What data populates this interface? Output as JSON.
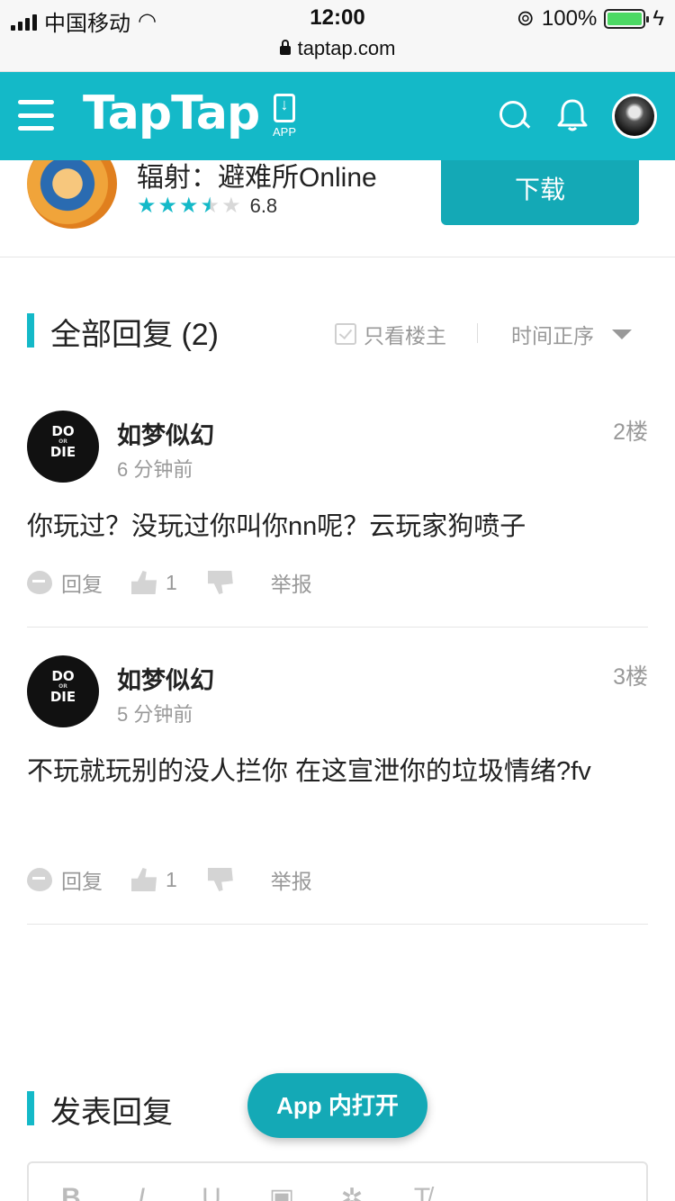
{
  "status_bar": {
    "carrier": "中国移动",
    "time": "12:00",
    "battery": "100%"
  },
  "browser": {
    "url": "taptap.com"
  },
  "header": {
    "logo": "TapTap",
    "app_label": "APP"
  },
  "game": {
    "title": "辐射：避难所Online",
    "rating": "6.8",
    "stars_filled": 3.5,
    "download": "下载"
  },
  "replies_section": {
    "title": "全部回复 (2)",
    "only_op": "只看楼主",
    "sort": "时间正序"
  },
  "replies": [
    {
      "name": "如梦似幻",
      "time": "6 分钟前",
      "floor": "2楼",
      "content": "你玩过？没玩过你叫你nn呢？云玩家狗喷子",
      "reply": "回复",
      "likes": "1",
      "report": "举报",
      "avatar_top": "DO",
      "avatar_mid": "OR",
      "avatar_bottom": "DIE"
    },
    {
      "name": "如梦似幻",
      "time": "5 分钟前",
      "floor": "3楼",
      "content": "不玩就玩别的没人拦你 在这宣泄你的垃圾情绪?fv",
      "reply": "回复",
      "likes": "1",
      "report": "举报",
      "avatar_top": "DO",
      "avatar_mid": "OR",
      "avatar_bottom": "DIE"
    }
  ],
  "compose": {
    "title": "发表回复",
    "open_in_app": "App 内打开",
    "tools": [
      "B",
      "I",
      "U",
      "▣",
      "✲",
      "T̸"
    ]
  },
  "colors": {
    "brand": "#14b9c8",
    "button": "#14a9b6"
  }
}
